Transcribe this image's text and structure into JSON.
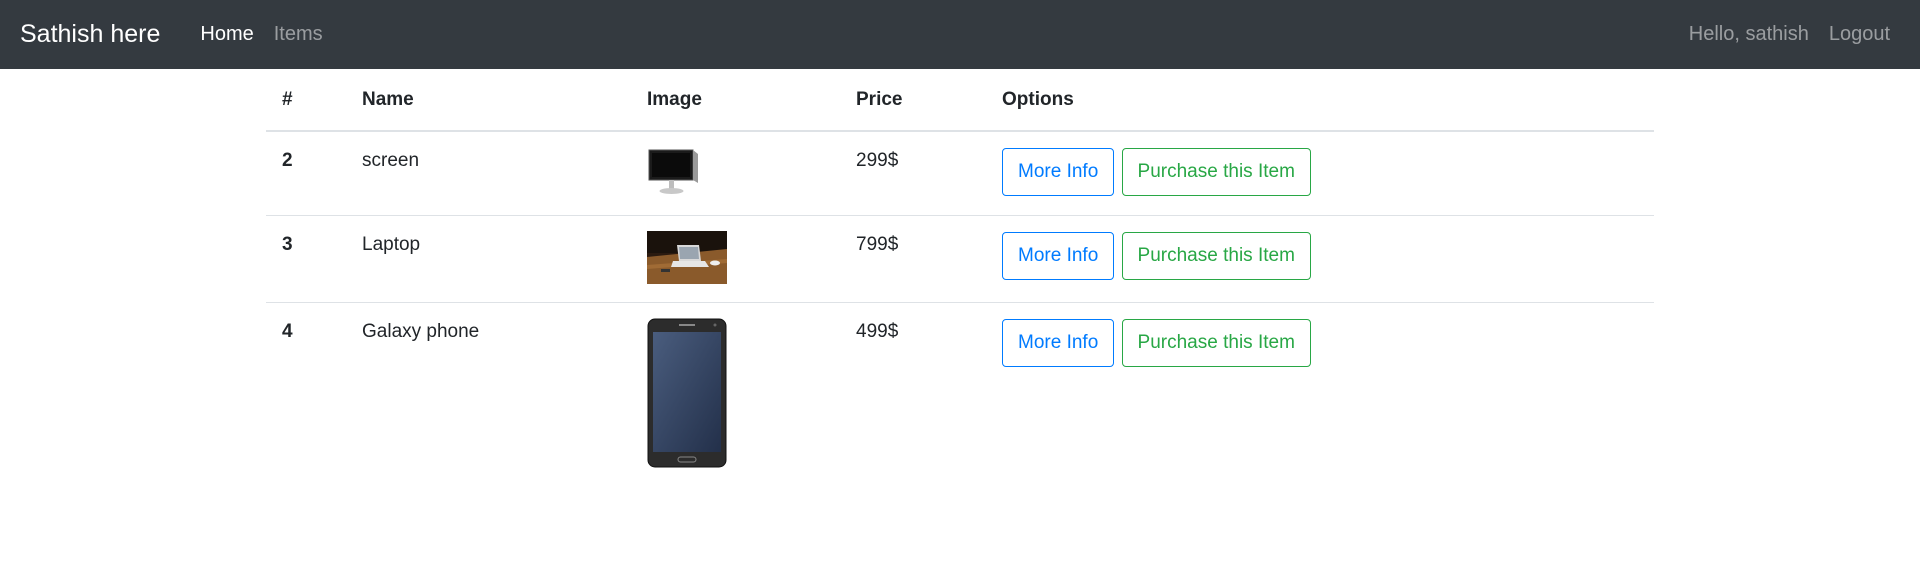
{
  "navbar": {
    "brand": "Sathish here",
    "links": [
      {
        "label": "Home"
      },
      {
        "label": "Items"
      }
    ],
    "greeting": "Hello, sathish",
    "logout": "Logout"
  },
  "table": {
    "headers": [
      "#",
      "Name",
      "Image",
      "Price",
      "Options"
    ],
    "rows": [
      {
        "id": "2",
        "name": "screen",
        "image": "monitor-image",
        "price": "299$",
        "more": "More Info",
        "buy": "Purchase this Item"
      },
      {
        "id": "3",
        "name": "Laptop",
        "image": "laptop-image",
        "price": "799$",
        "more": "More Info",
        "buy": "Purchase this Item"
      },
      {
        "id": "4",
        "name": "Galaxy phone",
        "image": "phone-image",
        "price": "499$",
        "more": "More Info",
        "buy": "Purchase this Item"
      }
    ]
  },
  "colors": {
    "navbar_bg": "#343a40",
    "primary": "#007bff",
    "success": "#28a745"
  }
}
